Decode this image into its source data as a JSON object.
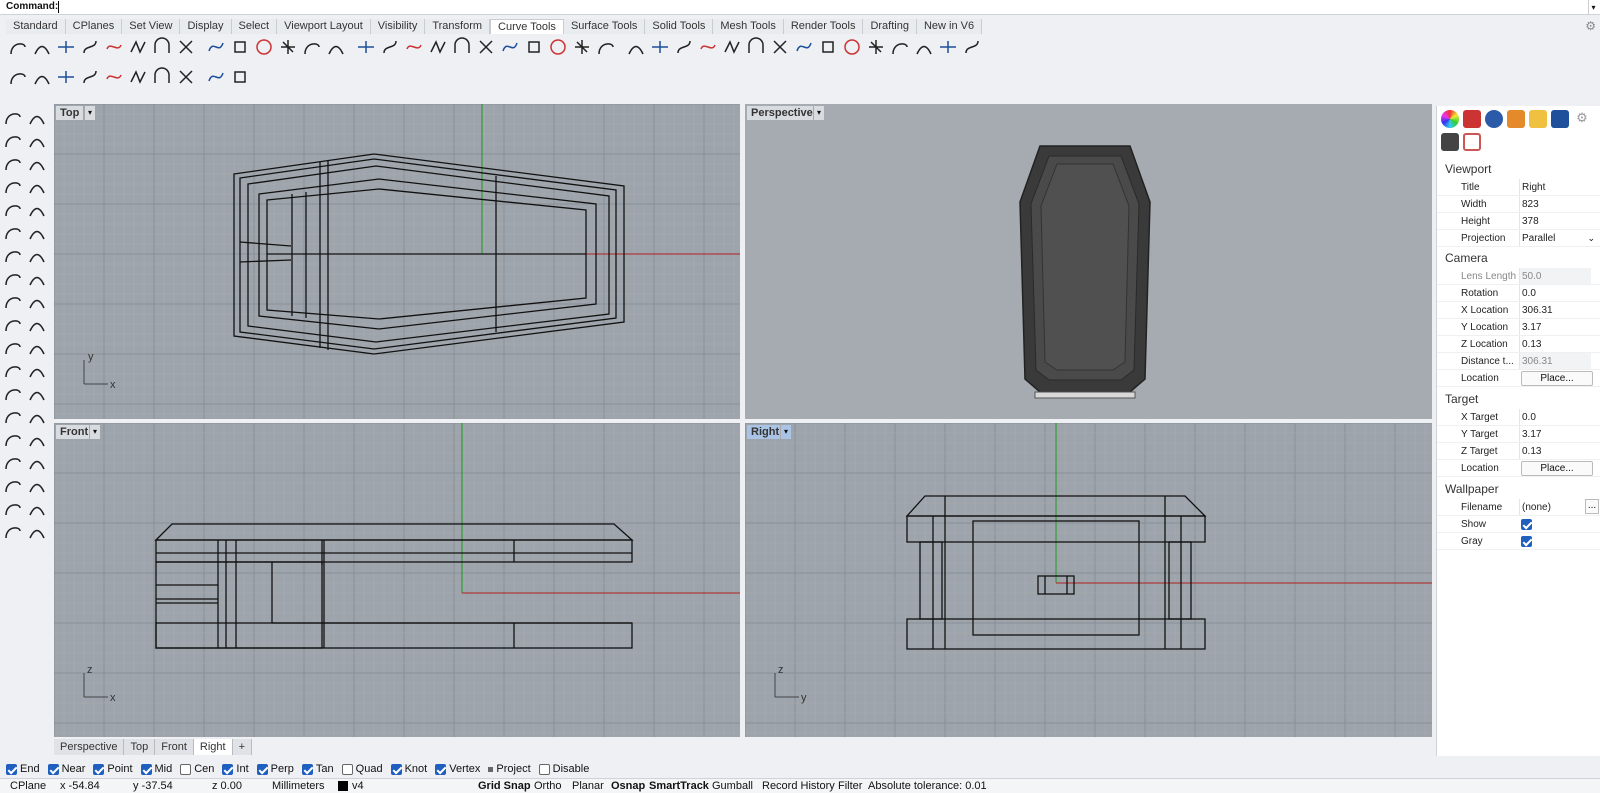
{
  "command": {
    "label": "Command:"
  },
  "menu_tabs": [
    "Standard",
    "CPlanes",
    "Set View",
    "Display",
    "Select",
    "Viewport Layout",
    "Visibility",
    "Transform",
    "Curve Tools",
    "Surface Tools",
    "Solid Tools",
    "Mesh Tools",
    "Render Tools",
    "Drafting",
    "New in V6"
  ],
  "active_tab": "Curve Tools",
  "viewports": {
    "top": {
      "title": "Top",
      "axis_x": "x",
      "axis_y": "y"
    },
    "perspective": {
      "title": "Perspective"
    },
    "front": {
      "title": "Front",
      "axis_x": "x",
      "axis_y": "z"
    },
    "right": {
      "title": "Right",
      "axis_x": "y",
      "axis_y": "z"
    }
  },
  "viewport_tabs": [
    "Perspective",
    "Top",
    "Front",
    "Right"
  ],
  "active_viewport_tab": "Right",
  "osnap": [
    {
      "label": "End",
      "checked": true
    },
    {
      "label": "Near",
      "checked": true
    },
    {
      "label": "Point",
      "checked": true
    },
    {
      "label": "Mid",
      "checked": true
    },
    {
      "label": "Cen",
      "checked": false
    },
    {
      "label": "Int",
      "checked": true
    },
    {
      "label": "Perp",
      "checked": true
    },
    {
      "label": "Tan",
      "checked": true
    },
    {
      "label": "Quad",
      "checked": false
    },
    {
      "label": "Knot",
      "checked": true
    },
    {
      "label": "Vertex",
      "checked": true
    },
    {
      "label": "Project",
      "checked": false,
      "square": true
    },
    {
      "label": "Disable",
      "checked": false
    }
  ],
  "status": {
    "cplane": "CPlane",
    "x": "x -54.84",
    "y": "y -37.54",
    "z": "z 0.00",
    "units": "Millimeters",
    "layer": "v4",
    "grid_snap": "Grid Snap",
    "ortho": "Ortho",
    "planar": "Planar",
    "osnap": "Osnap",
    "smarttrack": "SmartTrack",
    "gumball": "Gumball",
    "record_history": "Record History",
    "filter": "Filter",
    "tolerance": "Absolute tolerance: 0.01"
  },
  "properties": {
    "viewport_header": "Viewport",
    "title_label": "Title",
    "title_value": "Right",
    "width_label": "Width",
    "width_value": "823",
    "height_label": "Height",
    "height_value": "378",
    "projection_label": "Projection",
    "projection_value": "Parallel",
    "camera_header": "Camera",
    "lens_label": "Lens Length",
    "lens_value": "50.0",
    "rotation_label": "Rotation",
    "rotation_value": "0.0",
    "xloc_label": "X Location",
    "xloc_value": "306.31",
    "yloc_label": "Y Location",
    "yloc_value": "3.17",
    "zloc_label": "Z Location",
    "zloc_value": "0.13",
    "dist_label": "Distance t...",
    "dist_value": "306.31",
    "loc_label": "Location",
    "place_button": "Place...",
    "target_header": "Target",
    "xt_label": "X Target",
    "xt_value": "0.0",
    "yt_label": "Y Target",
    "yt_value": "3.17",
    "zt_label": "Z Target",
    "zt_value": "0.13",
    "tloc_label": "Location",
    "wallpaper_header": "Wallpaper",
    "filename_label": "Filename",
    "filename_value": "(none)",
    "browse_button": "...",
    "show_label": "Show",
    "gray_label": "Gray"
  },
  "colors": {
    "viewport_bg": "#9ea4ab",
    "grid_minor": "#a9aeb4",
    "grid_major": "#8a9097",
    "x_axis": "#b02020",
    "y_axis": "#1a9a1a"
  }
}
